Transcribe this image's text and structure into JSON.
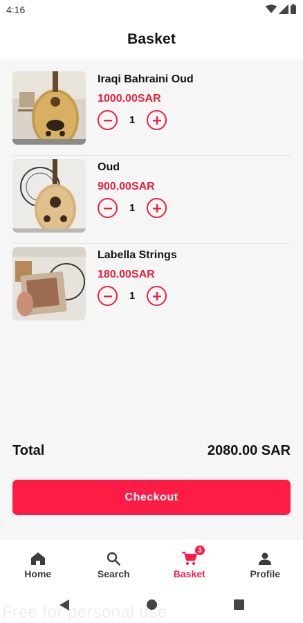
{
  "status_bar": {
    "time": "4:16",
    "icons": [
      "wifi-icon",
      "signal-icon",
      "battery-icon"
    ]
  },
  "header": {
    "title": "Basket"
  },
  "basket": {
    "items": [
      {
        "name": "Iraqi Bahraini Oud",
        "price": "1000.00SAR",
        "quantity": "1",
        "image": "oud-photo"
      },
      {
        "name": "Oud",
        "price": "900.00SAR",
        "quantity": "1",
        "image": "oud-photo"
      },
      {
        "name": "Labella Strings",
        "price": "180.00SAR",
        "quantity": "1",
        "image": "strings-photo"
      }
    ],
    "total_label": "Total",
    "total_value": "2080.00 SAR",
    "checkout_label": "Checkout"
  },
  "bottom_nav": {
    "items": [
      {
        "label": "Home",
        "icon": "home-icon"
      },
      {
        "label": "Search",
        "icon": "search-icon"
      },
      {
        "label": "Basket",
        "icon": "cart-icon",
        "badge": "3",
        "active": true
      },
      {
        "label": "Profile",
        "icon": "person-icon"
      }
    ]
  },
  "system_nav": {
    "buttons": [
      "back-icon",
      "home-circle-icon",
      "recents-icon"
    ]
  },
  "watermark": "Free for personal use",
  "colors": {
    "accent": "#fd1c45",
    "price": "#e5233d",
    "background": "#f6f6f6",
    "surface": "#ffffff"
  }
}
